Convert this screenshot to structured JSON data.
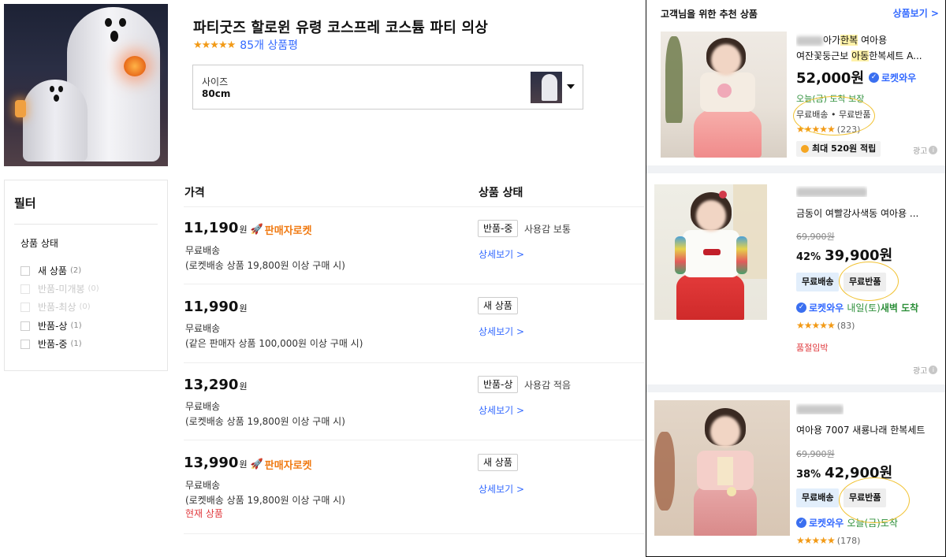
{
  "product": {
    "title": "파티굿즈 할로윈 유령 코스프레 코스튬 파티 의상",
    "stars": "★★★★★",
    "review_count": "85개 상품평",
    "rating": 4.5,
    "option": {
      "label": "사이즈",
      "value": "80cm"
    }
  },
  "filter": {
    "title": "필터",
    "section": "상품 상태",
    "items": [
      {
        "label": "새 상품",
        "count": "(2)",
        "enabled": true
      },
      {
        "label": "반품-미개봉",
        "count": "(0)",
        "enabled": false
      },
      {
        "label": "반품-최상",
        "count": "(0)",
        "enabled": false
      },
      {
        "label": "반품-상",
        "count": "(1)",
        "enabled": true
      },
      {
        "label": "반품-중",
        "count": "(1)",
        "enabled": true
      }
    ]
  },
  "table": {
    "headers": {
      "price": "가격",
      "condition": "상품 상태"
    },
    "rows": [
      {
        "price": "11,190",
        "won": "원",
        "rocket": "판매자로켓",
        "ship1": "무료배송",
        "ship2": "(로켓배송 상품 19,800원 이상 구매 시)",
        "badge": "반품-중",
        "cond_text": "사용감 보통",
        "link": "상세보기 >"
      },
      {
        "price": "11,990",
        "won": "원",
        "rocket": "",
        "ship1": "무료배송",
        "ship2": "(같은 판매자 상품 100,000원 이상 구매 시)",
        "badge": "새 상품",
        "cond_text": "",
        "link": "상세보기 >"
      },
      {
        "price": "13,290",
        "won": "원",
        "rocket": "",
        "ship1": "무료배송",
        "ship2": "(로켓배송 상품 19,800원 이상 구매 시)",
        "badge": "반품-상",
        "cond_text": "사용감 적음",
        "link": "상세보기 >"
      },
      {
        "price": "13,990",
        "won": "원",
        "rocket": "판매자로켓",
        "ship1": "무료배송",
        "ship2": "(로켓배송 상품 19,800원 이상 구매 시)",
        "badge": "새 상품",
        "cond_text": "",
        "link": "상세보기 >",
        "current": "현재 상품"
      }
    ]
  },
  "recommend": {
    "title": "고객님을 위한 추천 상품",
    "more": "상품보기 >",
    "cards": [
      {
        "name1_a": "아가",
        "name1_hl": "한복",
        "name1_b": " 여아용",
        "name2_a": "여잔꽃둥근보 ",
        "name2_hl": "아동",
        "name2_b": "한복세트 A...",
        "price": "52,000원",
        "rocketwow": "로켓와우",
        "arrival": "오늘(금) 도착 보장",
        "ship": "무료배송 • 무료반품",
        "stars": "★★★★★",
        "reviews": "(223)",
        "points": "최대 520원 적립",
        "ad": "광고"
      },
      {
        "name": "금동이 여빨강사색동 여아용 ...",
        "original": "69,900원",
        "discount": "42%",
        "price": "39,900원",
        "pill1": "무료배송",
        "pill2": "무료반품",
        "rocketwow": "로켓와우",
        "arrival_day": "내일(토)",
        "arrival_tail": " 새벽 도착",
        "stars": "★★★★★",
        "reviews": "(83)",
        "soldout": "품절임박",
        "ad": "광고"
      },
      {
        "name": "여아용 7007 새룡나래 한복세트",
        "original": "69,900원",
        "discount": "38%",
        "price": "42,900원",
        "pill1": "무료배송",
        "pill2": "무료반품",
        "rocketwow": "로켓와우",
        "arrival_day": "오늘(금)",
        "arrival_tail": " 도착",
        "stars": "★★★★★",
        "reviews": "(178)"
      }
    ]
  },
  "colors": {
    "link": "#346aff",
    "star": "#f29a16",
    "rocket": "#f07a12",
    "green": "#2d8f3a",
    "red": "#e03a3e"
  },
  "icons": [
    "star-icon",
    "rocket-icon",
    "caret-down-icon",
    "checkbox-icon",
    "rocketwow-icon",
    "coin-icon",
    "info-icon"
  ]
}
